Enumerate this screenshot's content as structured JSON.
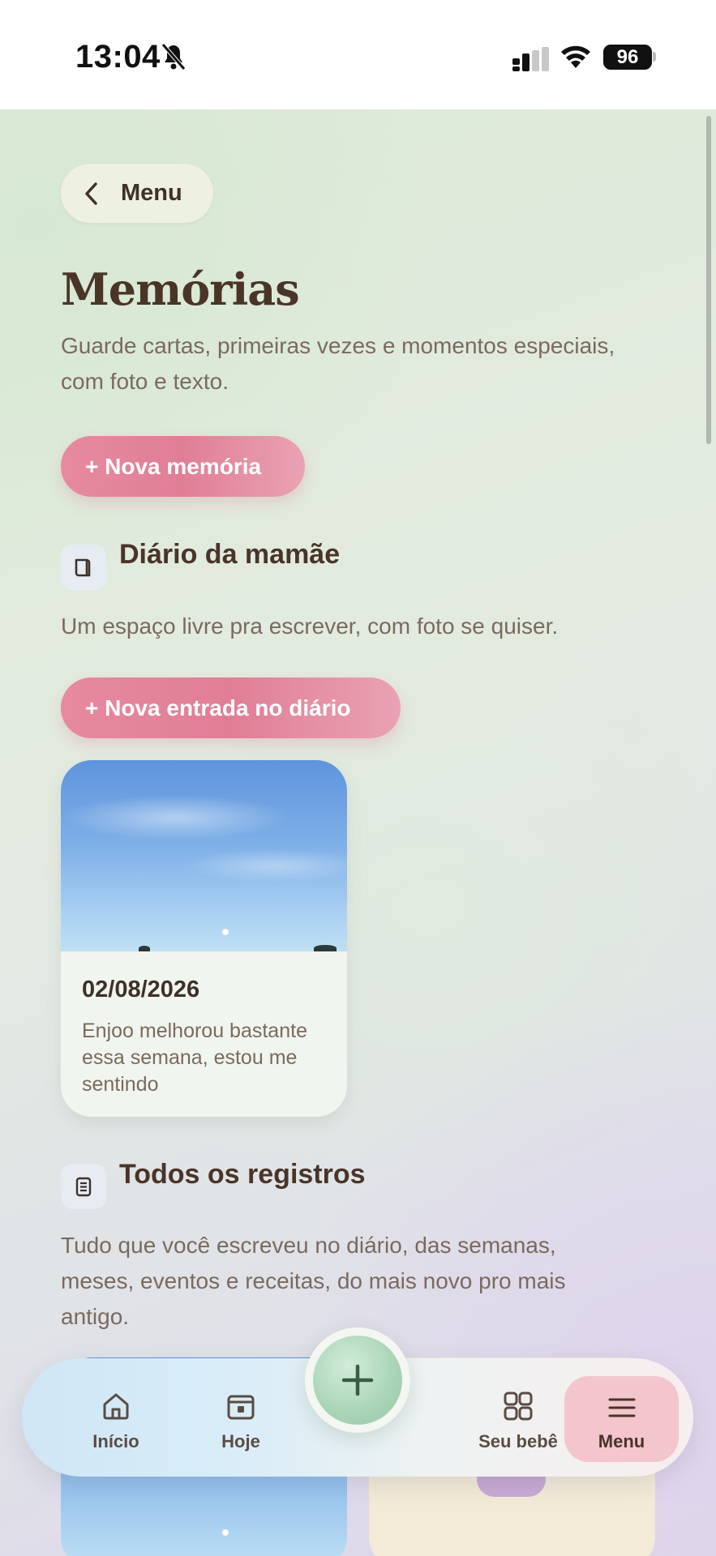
{
  "status_bar": {
    "time": "13:04",
    "battery": "96"
  },
  "header": {
    "back_label": "Menu",
    "title": "Memórias",
    "subtitle": "Guarde cartas, primeiras vezes e momentos especiais, com foto e texto."
  },
  "actions": {
    "new_memory": "+ Nova memória",
    "new_diary_entry": "+ Nova entrada no diário"
  },
  "diary_section": {
    "title": "Diário da mamãe",
    "description": "Um espaço livre pra escrever, com foto se quiser.",
    "entries": [
      {
        "date": "02/08/2026",
        "text": "Enjoo melhorou bastante essa semana, estou me sentindo"
      }
    ]
  },
  "records_section": {
    "title": "Todos os registros",
    "description": "Tudo que você escreveu no diário, das semanas, meses, eventos e receitas, do mais novo pro mais antigo."
  },
  "bottom_nav": {
    "items": [
      {
        "label": "Início",
        "icon": "home-icon"
      },
      {
        "label": "Hoje",
        "icon": "calendar-today-icon"
      },
      {
        "label": "Seu bebê",
        "icon": "grid-icon"
      },
      {
        "label": "Menu",
        "icon": "hamburger-menu-icon",
        "active": true
      }
    ],
    "fab_icon": "plus-icon"
  },
  "colors": {
    "accent_pink": "#e07e96",
    "title_brown": "#4a3428",
    "fab_green": "#a9d4b6",
    "menu_active_bg": "#f2c6cc"
  }
}
